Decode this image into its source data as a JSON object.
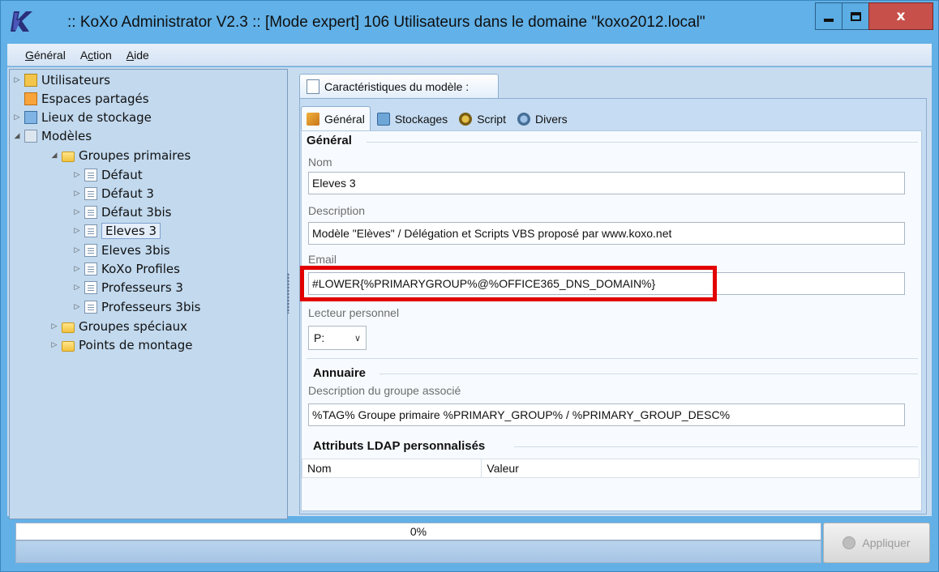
{
  "window": {
    "title": ":: KoXo Administrator V2.3 :: [Mode expert] 106 Utilisateurs dans le domaine \"koxo2012.local\"",
    "minimize_glyph": "–",
    "maximize_glyph": "☐",
    "close_glyph": "x"
  },
  "menu": {
    "items": [
      {
        "pre": "",
        "u": "G",
        "post": "énéral"
      },
      {
        "pre": "A",
        "u": "c",
        "post": "tion"
      },
      {
        "pre": "",
        "u": "A",
        "post": "ide"
      }
    ]
  },
  "tree": {
    "expand_glyph": "▷",
    "collapse_glyph": "◢",
    "items": [
      {
        "label": "Utilisateurs",
        "icon": "users-icon"
      },
      {
        "label": "Espaces partagés",
        "icon": "share-icon"
      },
      {
        "label": "Lieux de stockage",
        "icon": "storage-icon"
      },
      {
        "label": "Modèles",
        "icon": "model-icon"
      },
      {
        "label": "Groupes primaires",
        "icon": "folder-icon"
      },
      {
        "label": "Défaut",
        "icon": "doc-icon"
      },
      {
        "label": "Défaut 3",
        "icon": "doc-icon"
      },
      {
        "label": "Défaut 3bis",
        "icon": "doc-icon"
      },
      {
        "label": "Eleves 3",
        "icon": "doc-icon"
      },
      {
        "label": "Eleves 3bis",
        "icon": "doc-icon"
      },
      {
        "label": "KoXo Profiles",
        "icon": "doc-icon"
      },
      {
        "label": "Professeurs 3",
        "icon": "doc-icon"
      },
      {
        "label": "Professeurs 3bis",
        "icon": "doc-icon"
      },
      {
        "label": "Groupes spéciaux",
        "icon": "folder-icon"
      },
      {
        "label": "Points de montage",
        "icon": "folder-icon"
      }
    ]
  },
  "panel": {
    "outer_tab": "Caractéristiques du modèle :",
    "tabs": [
      "Général",
      "Stockages",
      "Script",
      "Divers"
    ],
    "general": {
      "section_title": "Général",
      "nom_label": "Nom",
      "nom_value": "Eleves 3",
      "description_label": "Description",
      "description_value": "Modèle \"Elèves\" / Délégation et Scripts VBS proposé par www.koxo.net",
      "email_label": "Email",
      "email_value": "#LOWER{%PRIMARYGROUP%@%OFFICE365_DNS_DOMAIN%}",
      "lecteur_label": "Lecteur personnel",
      "lecteur_value": "P:",
      "lecteur_chevron": "∨"
    },
    "annuaire": {
      "section_title": "Annuaire",
      "desc_label": "Description du groupe associé",
      "desc_value": "%TAG% Groupe primaire %PRIMARY_GROUP% / %PRIMARY_GROUP_DESC%"
    },
    "ldap": {
      "section_title": "Attributs LDAP personnalisés",
      "columns": [
        "Nom",
        "Valeur"
      ]
    }
  },
  "status": {
    "progress_text": "0%",
    "progress_fraction": 0,
    "apply_label": "Appliquer"
  },
  "colors": {
    "title_bar": "#62b1e8",
    "close_button": "#c7504a",
    "highlight_box": "#e20000"
  }
}
